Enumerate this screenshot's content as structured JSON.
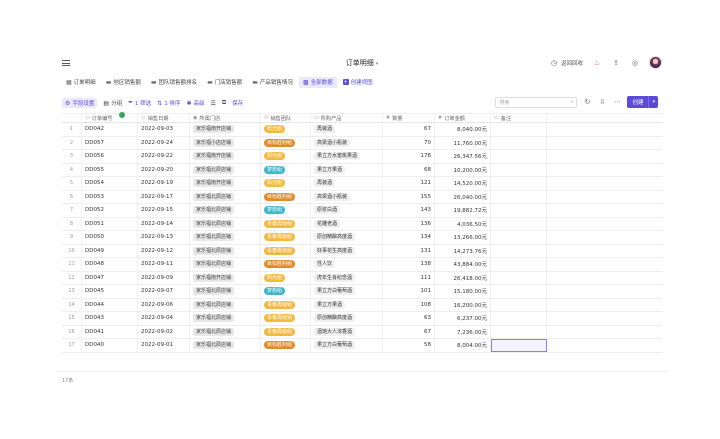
{
  "header": {
    "title": "订单明细",
    "back_label": "返回回收"
  },
  "tabs": [
    {
      "label": "订单明细",
      "icon": "table-icon",
      "active": false
    },
    {
      "label": "地区销售额",
      "icon": "folder-icon",
      "active": false
    },
    {
      "label": "团队销售额排名",
      "icon": "folder-icon",
      "active": false
    },
    {
      "label": "门店销售额",
      "icon": "folder-icon",
      "active": false
    },
    {
      "label": "产品销售情况",
      "icon": "folder-icon",
      "active": false
    },
    {
      "label": "全部数据",
      "icon": "grid-icon",
      "active": true
    },
    {
      "label": "创建视图",
      "icon": "plus-icon",
      "active": false
    }
  ],
  "toolbar": {
    "field_settings": "字段设置",
    "group": "分组",
    "filter": "1 筛选",
    "sort": "1 排序",
    "advanced": "高级",
    "save": "保存",
    "search_placeholder": "搜索",
    "create": "创建"
  },
  "columns": [
    "订单编号",
    "销售日期",
    "所属门店",
    "销售团队",
    "所购产品",
    "数量",
    "订单金额",
    "备注"
  ],
  "rows": [
    {
      "n": "1",
      "id": "DD042",
      "date": "2022-09-03",
      "store": "家乐福南开店铺",
      "team": "阳光组",
      "team_color": "#f3b93a",
      "product": "再装酒",
      "qty": "67",
      "amount": "8,040.00元"
    },
    {
      "n": "2",
      "id": "DD057",
      "date": "2022-09-24",
      "store": "家乐福小店店铺",
      "team": "目标胜利组",
      "team_color": "#e08a2a",
      "product": "高梁酒小瓶装",
      "qty": "70",
      "amount": "11,760.00元"
    },
    {
      "n": "3",
      "id": "DD056",
      "date": "2022-09-22",
      "store": "家乐福南开店铺",
      "team": "阳光组",
      "team_color": "#f3b93a",
      "product": "果立方水蜜桃果酒",
      "qty": "178",
      "amount": "26,347.56元"
    },
    {
      "n": "4",
      "id": "DD055",
      "date": "2022-09-20",
      "store": "家乐福北辰店铺",
      "team": "梦想组",
      "team_color": "#3fb6c8",
      "product": "果立方果酒",
      "qty": "68",
      "amount": "10,200.00元"
    },
    {
      "n": "5",
      "id": "DD054",
      "date": "2022-09-19",
      "store": "家乐福南开店铺",
      "team": "阳光组",
      "team_color": "#f3b93a",
      "product": "再装酒",
      "qty": "121",
      "amount": "14,520.00元"
    },
    {
      "n": "6",
      "id": "DD053",
      "date": "2022-09-17",
      "store": "家乐福北辰店铺",
      "team": "目标胜利组",
      "team_color": "#e08a2a",
      "product": "高梁酒小瓶装",
      "qty": "155",
      "amount": "26,040.00元"
    },
    {
      "n": "7",
      "id": "DD052",
      "date": "2022-09-15",
      "store": "家乐福北辰店铺",
      "team": "梦想组",
      "team_color": "#3fb6c8",
      "product": "原浆白酒",
      "qty": "143",
      "amount": "19,882.72元"
    },
    {
      "n": "8",
      "id": "DD051",
      "date": "2022-09-14",
      "store": "家乐福北辰店铺",
      "team": "青春再绽组",
      "team_color": "#f2b840",
      "product": "花雕老酒",
      "qty": "136",
      "amount": "4,036.50元"
    },
    {
      "n": "9",
      "id": "DD050",
      "date": "2022-09-13",
      "store": "家乐福北辰店铺",
      "team": "青春再绽组",
      "team_color": "#f2b840",
      "product": "原创精酿高度酒",
      "qty": "134",
      "amount": "13,266.00元"
    },
    {
      "n": "10",
      "id": "DD049",
      "date": "2022-09-12",
      "store": "家乐福北辰店铺",
      "team": "青春再绽组",
      "team_color": "#f2b840",
      "product": "好事花生高度酒",
      "qty": "131",
      "amount": "14,273.76元"
    },
    {
      "n": "11",
      "id": "DD048",
      "date": "2022-09-11",
      "store": "家乐福北辰店铺",
      "team": "目标胜利组",
      "team_color": "#e08a2a",
      "product": "性人饮",
      "qty": "138",
      "amount": "43,884.00元"
    },
    {
      "n": "12",
      "id": "DD047",
      "date": "2022-09-09",
      "store": "家乐福南开店铺",
      "team": "阳光组",
      "team_color": "#f3b93a",
      "product": "虎年生肖纪念酒",
      "qty": "111",
      "amount": "26,418.00元"
    },
    {
      "n": "13",
      "id": "DD045",
      "date": "2022-09-07",
      "store": "家乐福北辰店铺",
      "team": "梦想组",
      "team_color": "#3fb6c8",
      "product": "果立方白葡萄酒",
      "qty": "101",
      "amount": "15,180.00元"
    },
    {
      "n": "14",
      "id": "DD044",
      "date": "2022-09-06",
      "store": "家乐福北辰店铺",
      "team": "青春再绽组",
      "team_color": "#f2b840",
      "product": "果立方果酒",
      "qty": "108",
      "amount": "16,200.00元"
    },
    {
      "n": "15",
      "id": "DD043",
      "date": "2022-09-04",
      "store": "家乐福北辰店铺",
      "team": "青春再绽组",
      "team_color": "#f2b840",
      "product": "原创精酿高度酒",
      "qty": "63",
      "amount": "6,237.00元"
    },
    {
      "n": "16",
      "id": "DD041",
      "date": "2022-09-02",
      "store": "家乐福北辰店铺",
      "team": "青春再绽组",
      "team_color": "#f2b840",
      "product": "酒馆大人浓香酒",
      "qty": "67",
      "amount": "7,236.00元"
    },
    {
      "n": "17",
      "id": "DD040",
      "date": "2022-09-01",
      "store": "家乐福北辰店铺",
      "team": "目标胜利组",
      "team_color": "#e08a2a",
      "product": "果立方白葡萄酒",
      "qty": "58",
      "amount": "8,004.00元"
    }
  ],
  "footer": {
    "count": "17条"
  },
  "colors": {
    "accent": "#5b4bd6"
  }
}
